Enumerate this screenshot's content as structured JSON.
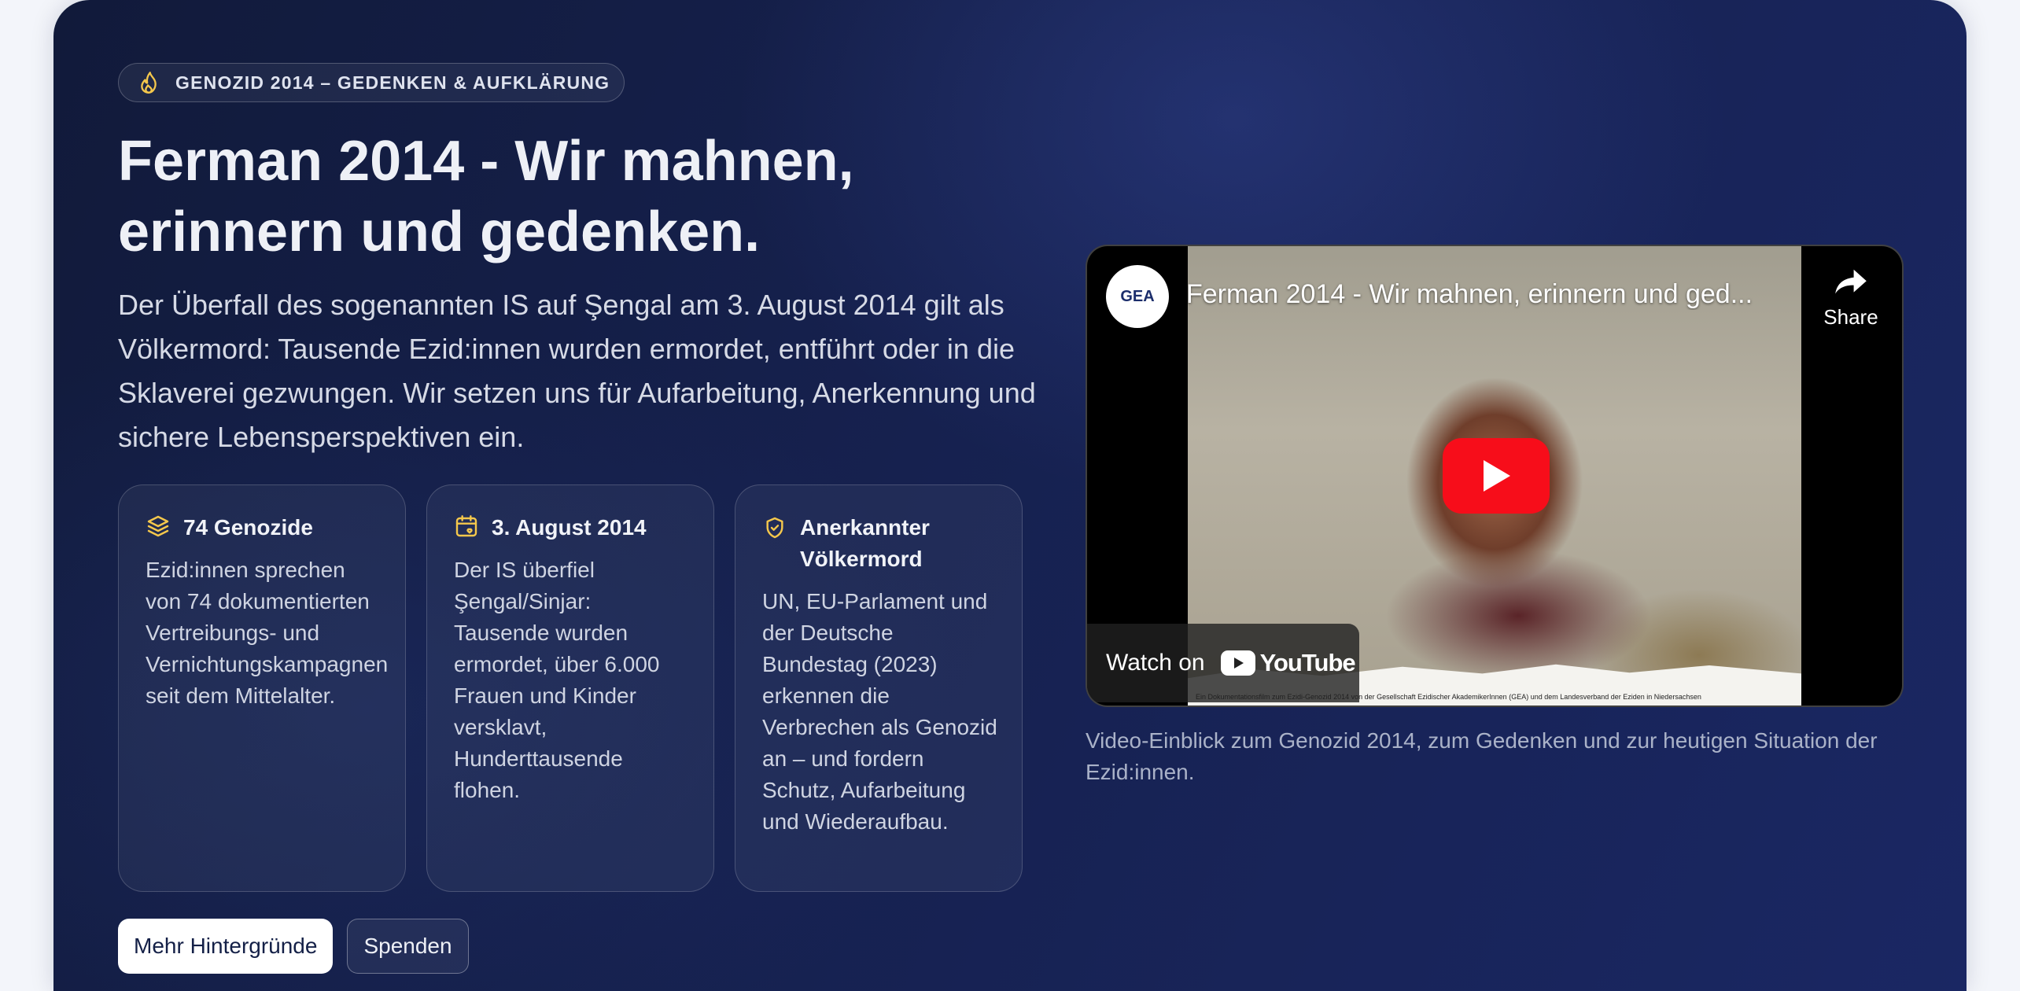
{
  "hero": {
    "badge": "GENOZID 2014 – GEDENKEN & AUFKLÄRUNG",
    "title_line1": "Ferman 2014 - Wir mahnen,",
    "title_line2": "erinnern und gedenken.",
    "lead": "Der Überfall des sogenannten IS auf Şengal am 3. August 2014 gilt als Völkermord: Tausende Ezid:innen wurden ermordet, entführt oder in die Sklaverei gezwungen. Wir setzen uns für Aufarbeitung, Anerkennung und sichere Lebensperspektiven ein."
  },
  "cards": [
    {
      "icon": "layers-icon",
      "heading": "74 Genozide",
      "body": "Ezid:innen sprechen von 74 dokumentierten Vertreibungs- und Vernichtungskampagnen seit dem Mittelalter."
    },
    {
      "icon": "calendar-heart-icon",
      "heading": "3. August 2014",
      "body": "Der IS überfiel Şengal/Sinjar: Tausende wurden ermordet, über 6.000 Frauen und Kinder versklavt, Hunderttausende flohen."
    },
    {
      "icon": "shield-check-icon",
      "heading": "Anerkannter Völkermord",
      "body": "UN, EU-Parlament und der Deutsche Bundestag (2023) erkennen die Verbrechen als Genozid an – und fordern Schutz, Aufarbeitung und Wiederaufbau."
    }
  ],
  "buttons": {
    "primary": "Mehr Hintergründe",
    "secondary": "Spenden"
  },
  "video": {
    "channel_logo": "GEA",
    "title": "Ferman 2014 - Wir mahnen, erinnern und ged...",
    "share": "Share",
    "watch_on": "Watch on",
    "youtube": "YouTube",
    "footer_text": "Ein Dokumentationsfilm zum Ezidi-Genozid 2014 von der Gesellschaft Ezidischer AkademikerInnen (GEA) und dem Landesverband der Eziden in Niedersachsen"
  },
  "caption": "Video-Einblick zum Genozid 2014, zum Gedenken und zur heutigen Situation der Ezid:innen.",
  "colors": {
    "accent": "#f5c84c",
    "background_dark": "#16214f",
    "play_red": "#f70d1a"
  }
}
